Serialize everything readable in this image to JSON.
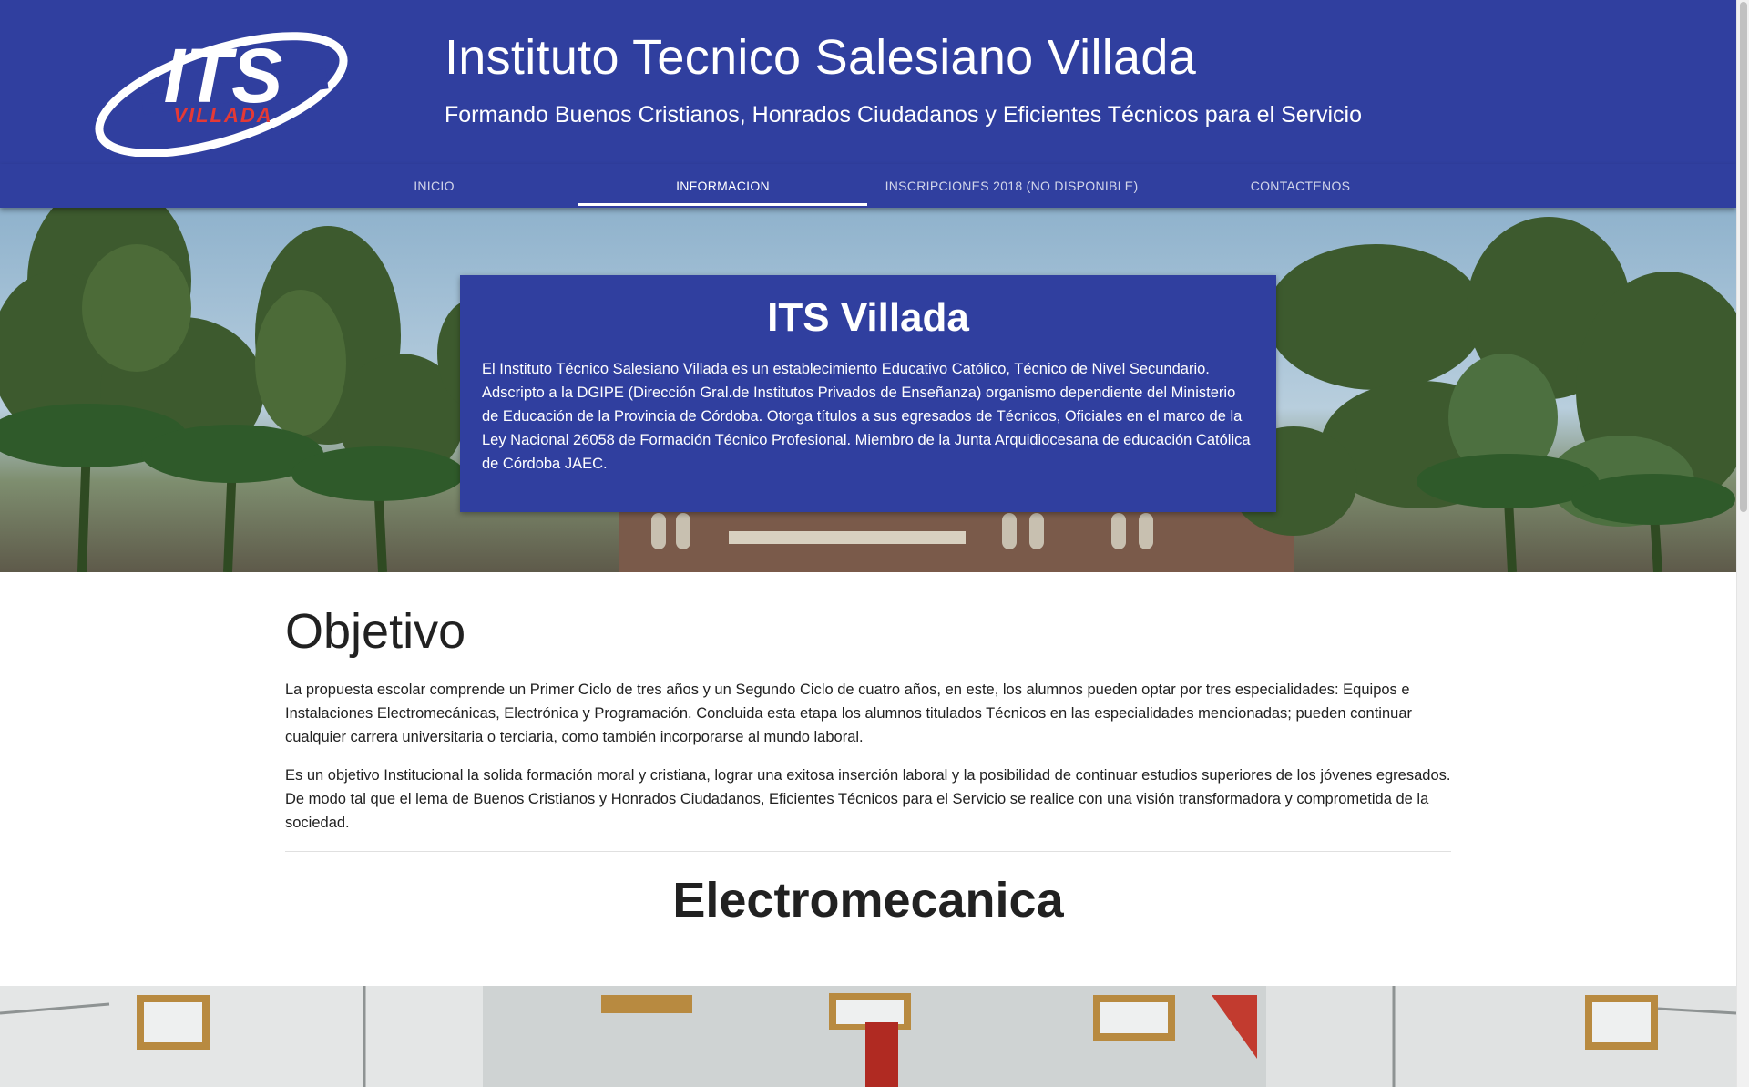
{
  "header": {
    "logo_alt": "ITS VILLADA",
    "logo_text": "ITS",
    "logo_subtext": "VILLADA",
    "title": "Instituto Tecnico Salesiano Villada",
    "subtitle": "Formando Buenos Cristianos, Honrados Ciudadanos y Eficientes Técnicos para el Servicio"
  },
  "nav": {
    "items": [
      {
        "label": "INICIO",
        "active": false
      },
      {
        "label": "INFORMACION",
        "active": true
      },
      {
        "label": "INSCRIPCIONES 2018 (NO DISPONIBLE)",
        "active": false
      },
      {
        "label": "CONTACTENOS",
        "active": false
      }
    ]
  },
  "card": {
    "title": "ITS Villada",
    "text": "El Instituto Técnico Salesiano Villada es un establecimiento Educativo Católico, Técnico de Nivel Secundario. Adscripto a la DGIPE (Dirección Gral.de Institutos Privados de Enseñanza) organismo dependiente del Ministerio de Educación de la Provincia de Córdoba. Otorga títulos a sus egresados de Técnicos, Oficiales en el marco de la Ley Nacional 26058 de Formación Técnico Profesional. Miembro de la Junta Arquidiocesana de educación Católica de Córdoba JAEC."
  },
  "objetivo": {
    "title": "Objetivo",
    "paragraph1": "La propuesta escolar comprende un Primer Ciclo de tres años y un Segundo Ciclo de cuatro años, en este, los alumnos pueden optar por tres especialidades: Equipos e Instalaciones Electromecánicas, Electrónica y Programación. Concluida esta etapa los alumnos titulados Técnicos en las especialidades mencionadas; pueden continuar cualquier carrera universitaria o terciaria, como también incorporarse al mundo laboral.",
    "paragraph2": "Es un objetivo Institucional la solida formación moral y cristiana, lograr una exitosa inserción laboral y la posibilidad de continuar estudios superiores de los jóvenes egresados. De modo tal que el lema de Buenos Cristianos y Honrados Ciudadanos, Eficientes Técnicos para el Servicio se realice con una visión transformadora y comprometida de la sociedad."
  },
  "electromecanica": {
    "title": "Electromecanica"
  },
  "colors": {
    "primary": "#303f9f",
    "logo_red": "#e53935",
    "text": "#212121"
  }
}
